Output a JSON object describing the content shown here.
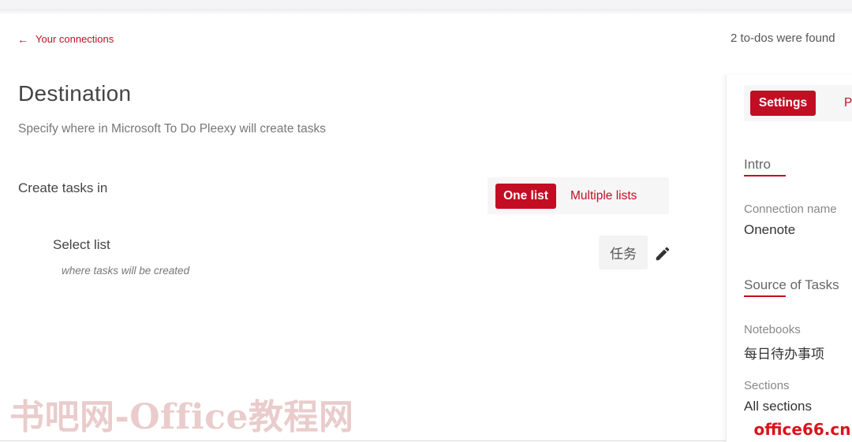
{
  "header": {
    "back_label": "Your connections",
    "todo_count": "2 to-dos were found"
  },
  "destination": {
    "title": "Destination",
    "subtitle": "Specify where in Microsoft To Do Pleexy will create tasks",
    "create_label": "Create tasks in",
    "toggle": {
      "active": "One list",
      "inactive": "Multiple lists"
    },
    "select_list": {
      "label": "Select list",
      "hint": "where tasks will be created",
      "value": "任务"
    }
  },
  "panel": {
    "tabs": {
      "active": "Settings",
      "other": "P"
    },
    "intro": {
      "heading": "Intro",
      "connection_name_label": "Connection name",
      "connection_name_value": "Onenote"
    },
    "source": {
      "heading": "Source of Tasks",
      "notebooks_label": "Notebooks",
      "notebooks_value": "每日待办事项",
      "sections_label": "Sections",
      "sections_value": "All sections"
    }
  },
  "watermarks": {
    "left": "书吧网-Office教程网",
    "right": "office66.cn"
  },
  "colors": {
    "accent": "#c30d23",
    "text": "#444444",
    "muted": "#777777",
    "chip_bg": "#f3f3f4"
  },
  "icons": {
    "back": "arrow-left-icon",
    "edit": "pencil-icon"
  }
}
